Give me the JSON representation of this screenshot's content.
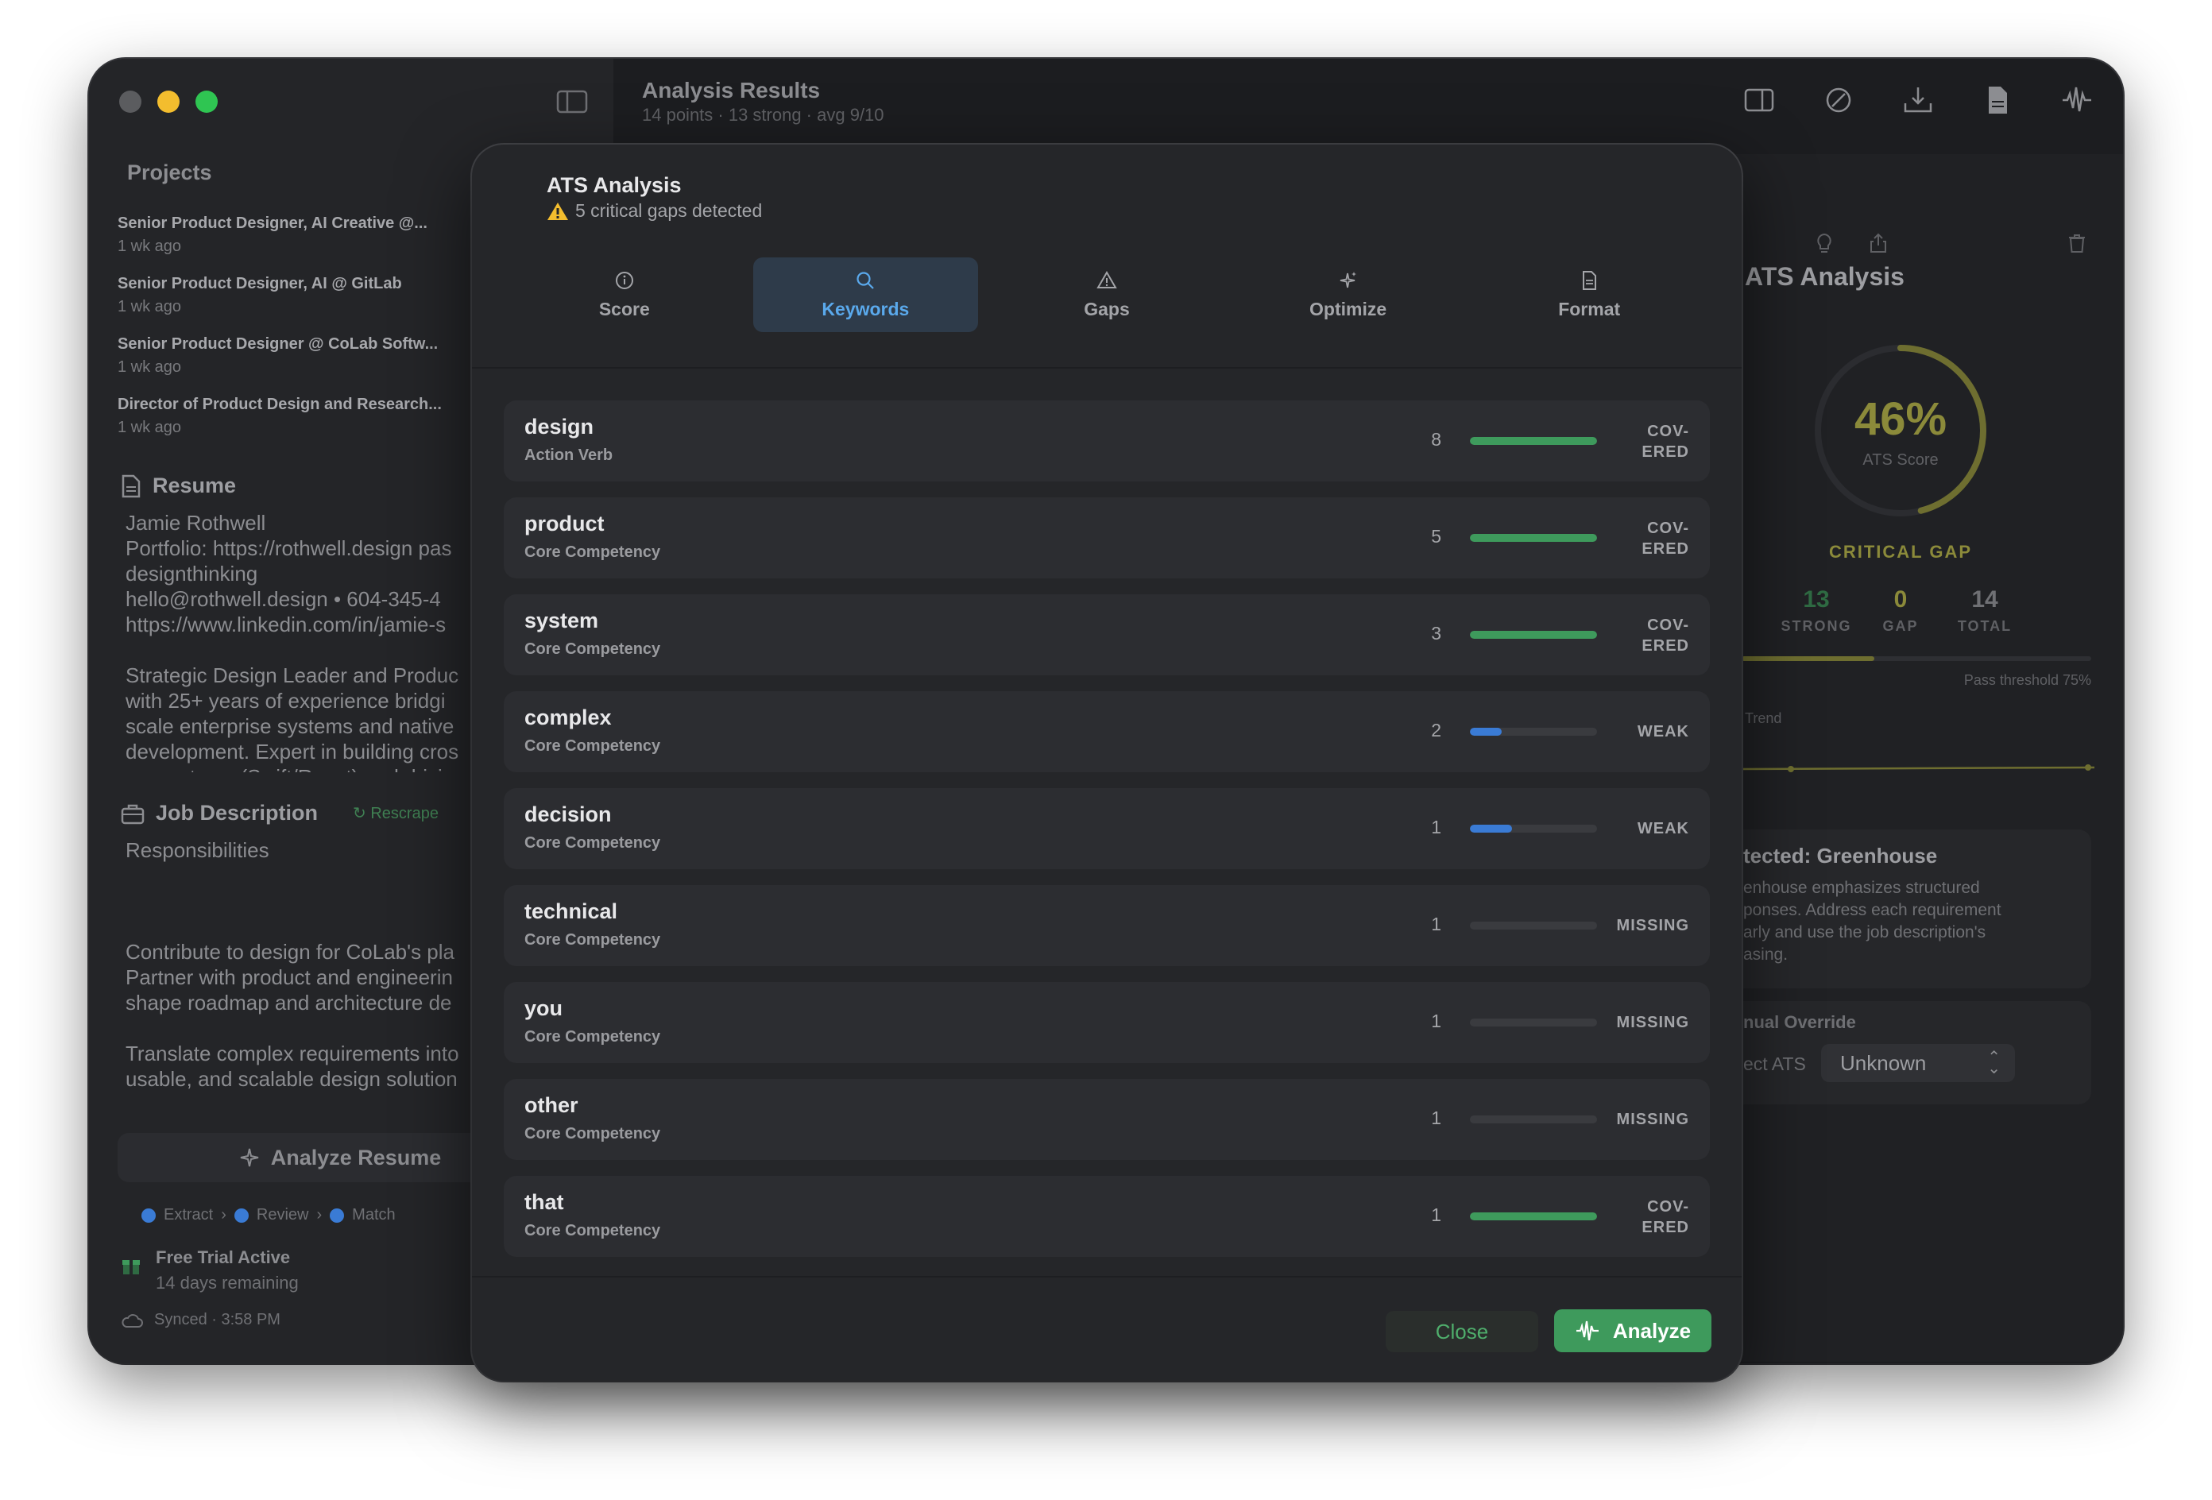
{
  "sidebar": {
    "projects_title": "Projects",
    "projects": [
      {
        "name": "Senior Product Designer, AI Creative @...",
        "time": "1 wk ago"
      },
      {
        "name": "Senior Product Designer, AI @ GitLab",
        "time": "1 wk ago"
      },
      {
        "name": "Senior Product Designer @ CoLab Softw...",
        "time": "1 wk ago"
      },
      {
        "name": "Director of Product Design and Research...",
        "time": "1 wk ago"
      }
    ],
    "resume_title": "Resume",
    "resume_text": "Jamie Rothwell\nPortfolio: https://rothwell.design pas\ndesignthinking\nhello@rothwell.design • 604-345-4\nhttps://www.linkedin.com/in/jamie-s\n\nStrategic Design Leader and Produc\nwith 25+ years of experience bridgi\nscale enterprise systems and native\ndevelopment. Expert in building cros\necosystems (Swift/React) and drivi",
    "jd_title": "Job Description",
    "rescrape": "Rescrape",
    "jd_text": "Responsibilities\n\n\n\nContribute to design for CoLab's pla\nPartner with product and engineerin\nshape roadmap and architecture de\n\nTranslate complex requirements into\nusable, and scalable design solution",
    "analyze_resume": "Analyze Resume",
    "steps": [
      "Extract",
      "Review",
      "Match"
    ],
    "trial_title": "Free Trial Active",
    "trial_sub": "14 days remaining",
    "synced": "Synced · 3:58 PM"
  },
  "main": {
    "title": "Analysis Results",
    "subtitle": "14 points · 13 strong · avg 9/10"
  },
  "right_panel": {
    "title": "ATS Analysis",
    "score_pct": "46%",
    "score_value": 0.46,
    "score_label": "ATS Score",
    "status": "CRITICAL GAP",
    "stats": [
      {
        "value": "13",
        "label": "STRONG",
        "color": "#3e9a5c"
      },
      {
        "value": "0",
        "label": "GAP",
        "color": "#8b8a3a"
      },
      {
        "value": "14",
        "label": "TOTAL",
        "color": "#6f7074"
      }
    ],
    "pass_threshold": "Pass threshold 75%",
    "trend_label": "Trend",
    "detected_title": "tected: Greenhouse",
    "detected_body": "enhouse emphasizes structured\nponses. Address each requirement\narly and use the job description's\nasing.",
    "override_title": "nual Override",
    "override_label": "ect ATS",
    "override_value": "Unknown"
  },
  "modal": {
    "title": "ATS Analysis",
    "warning": "5 critical gaps detected",
    "tabs": [
      {
        "label": "Score",
        "icon": "info-icon"
      },
      {
        "label": "Keywords",
        "icon": "search-icon"
      },
      {
        "label": "Gaps",
        "icon": "warning-icon"
      },
      {
        "label": "Optimize",
        "icon": "sparkle-icon"
      },
      {
        "label": "Format",
        "icon": "document-icon"
      }
    ],
    "active_tab": "Keywords",
    "keywords": [
      {
        "word": "design",
        "category": "Action Verb",
        "count": "8",
        "status": "COV-\nERED",
        "level": 1.0
      },
      {
        "word": "product",
        "category": "Core Competency",
        "count": "5",
        "status": "COV-\nERED",
        "level": 1.0
      },
      {
        "word": "system",
        "category": "Core Competency",
        "count": "3",
        "status": "COV-\nERED",
        "level": 1.0
      },
      {
        "word": "complex",
        "category": "Core Competency",
        "count": "2",
        "status": "WEAK",
        "level": 0.25
      },
      {
        "word": "decision",
        "category": "Core Competency",
        "count": "1",
        "status": "WEAK",
        "level": 0.33
      },
      {
        "word": "technical",
        "category": "Core Competency",
        "count": "1",
        "status": "MISSING",
        "level": 0
      },
      {
        "word": "you",
        "category": "Core Competency",
        "count": "1",
        "status": "MISSING",
        "level": 0
      },
      {
        "word": "other",
        "category": "Core Competency",
        "count": "1",
        "status": "MISSING",
        "level": 0
      },
      {
        "word": "that",
        "category": "Core Competency",
        "count": "1",
        "status": "COV-\nERED",
        "level": 1.0
      }
    ],
    "close": "Close",
    "analyze": "Analyze"
  },
  "colors": {
    "covered": "#3e9a5c",
    "weak": "#3a7bd5",
    "accent": "#5aa9ec"
  }
}
